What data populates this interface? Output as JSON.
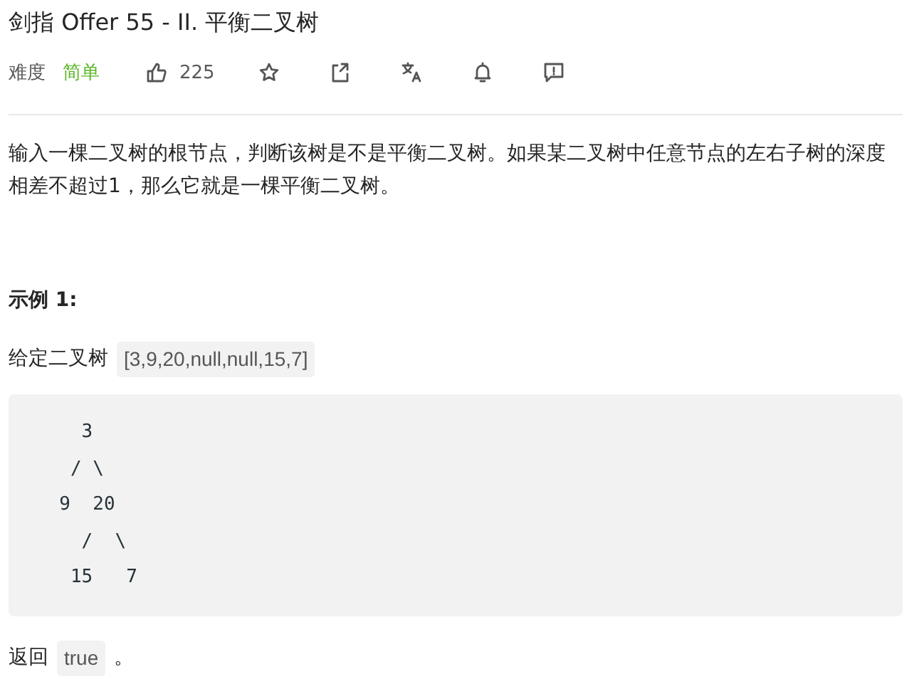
{
  "title": "剑指 Offer 55 - II. 平衡二叉树",
  "meta": {
    "difficulty_label": "难度",
    "difficulty": "简单",
    "likes": "225"
  },
  "toolbar": [
    {
      "kind": "star"
    },
    {
      "kind": "share"
    },
    {
      "kind": "translate"
    },
    {
      "kind": "bell"
    },
    {
      "kind": "feedback"
    }
  ],
  "description": "输入一棵二叉树的根节点，判断该树是不是平衡二叉树。如果某二叉树中任意节点的左右子树的深度相差不超过1，那么它就是一棵平衡二叉树。",
  "example": {
    "heading": "示例 1:",
    "given_label": "给定二叉树",
    "given_value": "[3,9,20,null,null,15,7]",
    "code_lines": [
      "    3",
      "   / \\",
      "  9  20",
      "    /  \\",
      "   15   7"
    ],
    "return_label": "返回",
    "return_value": "true",
    "return_suffix": "。"
  }
}
